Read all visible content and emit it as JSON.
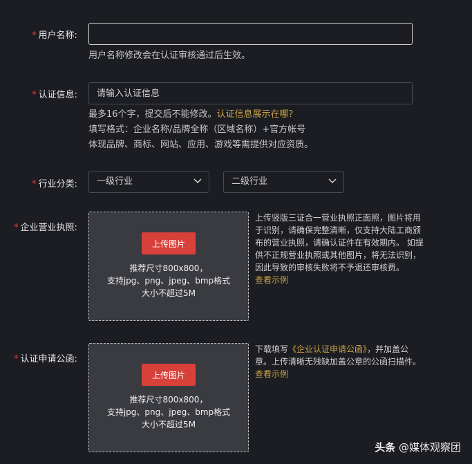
{
  "form": {
    "username": {
      "label": "用户名称:",
      "value": "",
      "hint": "用户名称修改会在认证审核通过后生效。"
    },
    "auth_info": {
      "label": "认证信息:",
      "placeholder": "请输入认证信息",
      "hint_line1": "最多16个字，提交后不能修改。",
      "hint_link": "认证信息展示在哪？",
      "hint_line2": "填写格式：企业名称/品牌全称（区域名称）+官方帐号",
      "hint_line3": "体现品牌、商标、网站、应用、游戏等需提供对应资质。"
    },
    "industry": {
      "label": "行业分类:",
      "primary": "一级行业",
      "secondary": "二级行业"
    },
    "license": {
      "label": "企业营业执照:",
      "upload_button": "上传图片",
      "spec_line1": "推荐尺寸800x800，",
      "spec_line2": "支持jpg、png、jpeg、bmp格式",
      "spec_line3": "大小不超过5M",
      "description": "上传竖版三证合一营业执照正面照，图片将用于识别，请确保完整清晰，仅支持大陆工商颁布的营业执照，请确认证件在有效期内。 如提供不正规营业执照或其他图片，将无法识别，因此导致的审核失败将不予退还审核费。",
      "example_link": "查看示例"
    },
    "letter": {
      "label": "认证申请公函:",
      "upload_button": "上传图片",
      "spec_line1": "推荐尺寸800x800，",
      "spec_line2": "支持jpg、png、jpeg、bmp格式",
      "spec_line3": "大小不超过5M",
      "desc_prefix": "下载填写",
      "desc_link": "《企业认证申请公函》",
      "desc_suffix": "，并加盖公章。上传清晰无残缺加盖公章的公函扫描件。",
      "example_link": "查看示例"
    }
  },
  "watermark": {
    "brand": "头条",
    "author": "@媒体观察团"
  },
  "colors": {
    "background": "#1c1d22",
    "required_star": "#e23c3c",
    "link": "#c9a245",
    "upload_button": "#d8403a",
    "upload_area": "#3a3b41"
  }
}
